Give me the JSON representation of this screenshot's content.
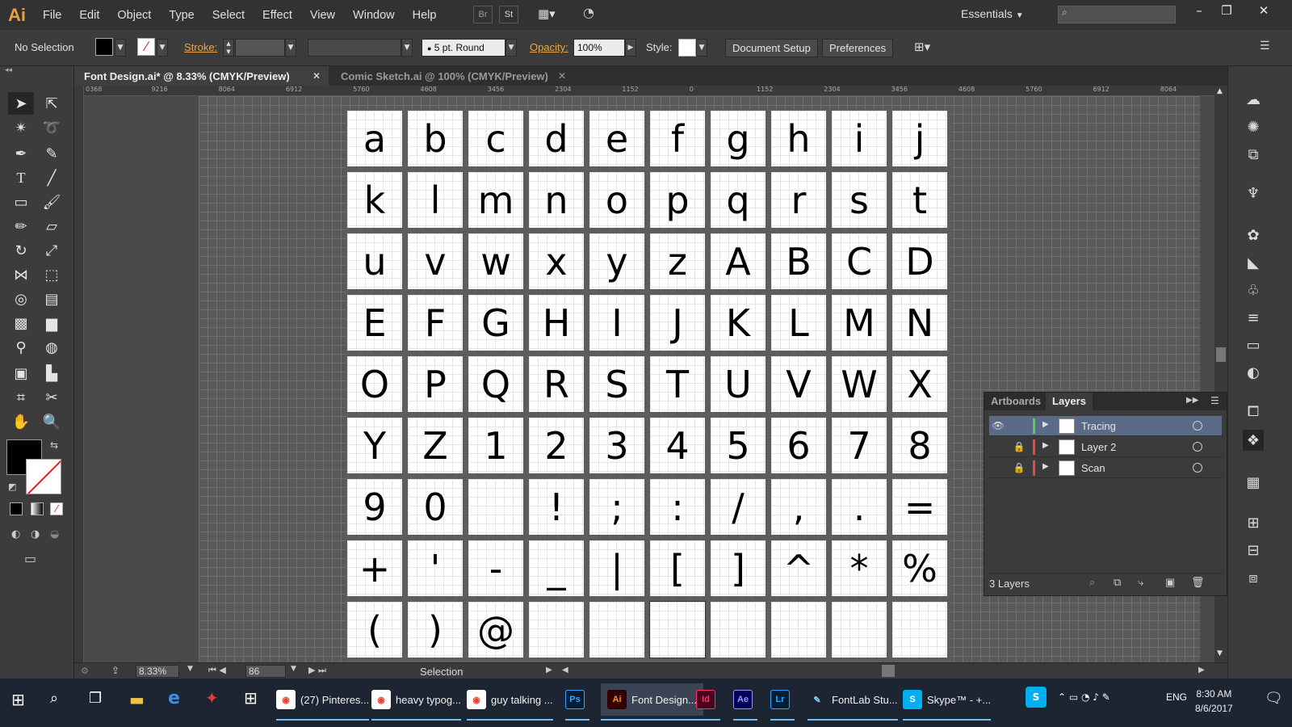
{
  "app": {
    "logo": "Ai"
  },
  "menu": [
    "File",
    "Edit",
    "Object",
    "Type",
    "Select",
    "Effect",
    "View",
    "Window",
    "Help"
  ],
  "menubar_buttons": {
    "bridge": "Br",
    "stock": "St"
  },
  "workspace": "Essentials",
  "window_controls": {
    "minimize": "–",
    "restore": "❐",
    "close": "✕"
  },
  "control_bar": {
    "selection": "No Selection",
    "stroke_label": "Stroke:",
    "brush": "5 pt. Round",
    "opacity_label": "Opacity:",
    "opacity_value": "100%",
    "style_label": "Style:",
    "doc_setup": "Document Setup",
    "preferences": "Preferences"
  },
  "tabs": [
    {
      "label": "Font Design.ai* @ 8.33% (CMYK/Preview)",
      "close": "✕"
    },
    {
      "label": "Comic Sketch.ai @ 100% (CMYK/Preview)",
      "close": "✕"
    }
  ],
  "ruler_top": [
    "0368",
    "9216",
    "8064",
    "6912",
    "5760",
    "4608",
    "3456",
    "2304",
    "1152",
    "0",
    "1152",
    "2304",
    "3456",
    "4608",
    "5760",
    "6912",
    "8064"
  ],
  "glyphs": [
    [
      "a",
      "b",
      "c",
      "d",
      "e",
      "f",
      "g",
      "h",
      "i",
      "j"
    ],
    [
      "k",
      "l",
      "m",
      "n",
      "o",
      "p",
      "q",
      "r",
      "s",
      "t"
    ],
    [
      "u",
      "v",
      "w",
      "x",
      "y",
      "z",
      "A",
      "B",
      "C",
      "D"
    ],
    [
      "E",
      "F",
      "G",
      "H",
      "I",
      "J",
      "K",
      "L",
      "M",
      "N"
    ],
    [
      "O",
      "P",
      "Q",
      "R",
      "S",
      "T",
      "U",
      "V",
      "W",
      "X"
    ],
    [
      "Y",
      "Z",
      "1",
      "2",
      "3",
      "4",
      "5",
      "6",
      "7",
      "8"
    ],
    [
      "9",
      "0",
      "",
      "!",
      ";",
      ":",
      "/",
      ",",
      ".",
      "="
    ],
    [
      "+",
      "'",
      "-",
      "_",
      "|",
      "[",
      "]",
      "^",
      "*",
      "%"
    ],
    [
      "(",
      ")",
      "@",
      "",
      "",
      "",
      "",
      "",
      "",
      ""
    ]
  ],
  "layers_panel": {
    "tabs": [
      "Artboards",
      "Layers"
    ],
    "layers": [
      {
        "name": "Tracing",
        "color": "#4fd14f"
      },
      {
        "name": "Layer 2",
        "color": "#e24a4a"
      },
      {
        "name": "Scan",
        "color": "#e24a4a"
      }
    ],
    "count": "3 Layers"
  },
  "status_bar": {
    "zoom": "8.33%",
    "page": "86",
    "tool": "Selection"
  },
  "taskbar": {
    "apps": [
      {
        "label": "(27) Pinteres...",
        "icon": "chrome"
      },
      {
        "label": "heavy typog...",
        "icon": "chrome"
      },
      {
        "label": "guy talking ...",
        "icon": "chrome"
      },
      {
        "label": "Ps",
        "icon": "photoshop"
      },
      {
        "label": "Font Design...",
        "icon": "illustrator",
        "icon_text": "Ai"
      },
      {
        "label": "Id",
        "icon": "indesign"
      },
      {
        "label": "Ae",
        "icon": "aftereffects"
      },
      {
        "label": "Lr",
        "icon": "lightroom"
      },
      {
        "label": "FontLab Stu...",
        "icon": "fontlab"
      },
      {
        "label": "Skype™ - +...",
        "icon": "skype"
      }
    ],
    "lang": "ENG",
    "time": "8:30 AM",
    "date": "8/6/2017"
  },
  "colors": {
    "accent_orange": "#f0a63c",
    "layer_selected": "#5b6a87",
    "taskbar": "#1d2532"
  }
}
